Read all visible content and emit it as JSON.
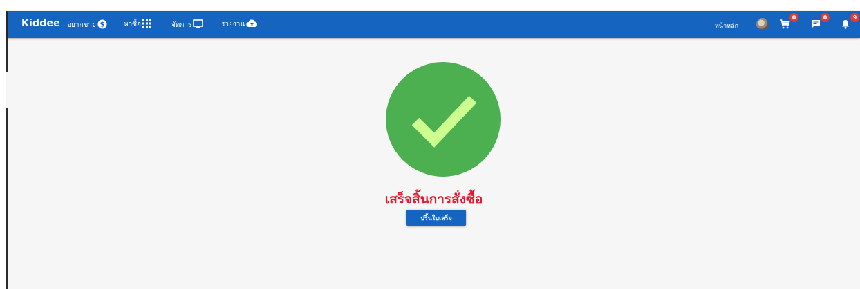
{
  "navbar": {
    "brand": "Kiddee",
    "items": [
      {
        "label": "อยากขาย",
        "icon": "dollar-circle-icon"
      },
      {
        "label": "หาซื้อ",
        "icon": "grid-icon"
      },
      {
        "label": "จัดการ",
        "icon": "monitor-icon"
      },
      {
        "label": "รายงาน",
        "icon": "cloud-upload-icon"
      }
    ],
    "home_label": "หน้าหลัก",
    "cart_count": "0",
    "message_count": "0",
    "notification_count": "9"
  },
  "main": {
    "success_icon": "check-circle-icon",
    "message": "เสร็จสิ้นการสั่งซื้อ",
    "print_button_label": "ปริ้นใบเสร็จ"
  },
  "colors": {
    "navbar": "#1565c0",
    "check_circle": "#4caf50",
    "checkmark": "#ccff90",
    "success_text": "#e8162a",
    "badge": "#e53935"
  }
}
